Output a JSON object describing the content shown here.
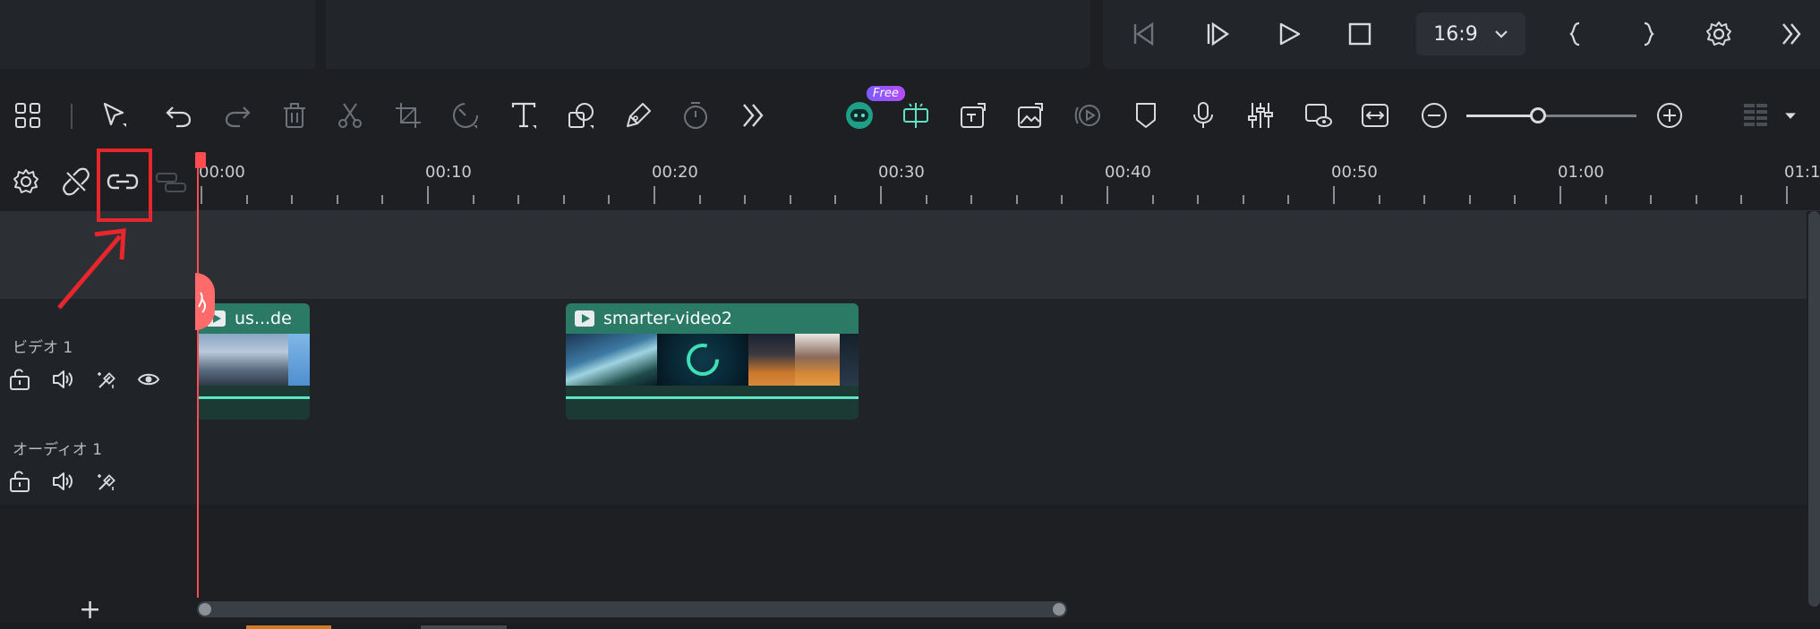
{
  "player": {
    "aspect_ratio": "16:9",
    "buttons": [
      "prev-frame",
      "next-frame",
      "play",
      "stop",
      "mark-in",
      "mark-out",
      "settings",
      "more"
    ]
  },
  "toolbar": {
    "ai_badge": "Free",
    "icons": [
      "layout-icon",
      "select-icon",
      "undo-icon",
      "redo-icon",
      "delete-icon",
      "cut-icon",
      "crop-icon",
      "speed-icon",
      "text-icon",
      "shape-icon",
      "pen-icon",
      "timer-icon",
      "more-icon",
      "ai-robot-icon",
      "split-screen-icon",
      "export-icon",
      "image-edit-icon",
      "motion-icon",
      "marker-icon",
      "mic-icon",
      "mixer-icon",
      "preview-icon",
      "fit-icon",
      "zoom-out-icon",
      "zoom-in-icon",
      "grid-icon",
      "dropdown-icon"
    ],
    "zoom_level": 0.42
  },
  "track_header_icons": [
    "gear-icon",
    "unlink-icon",
    "link-icon",
    "chain-icon"
  ],
  "ruler": {
    "labels": [
      "00:00",
      "00:10",
      "00:20",
      "00:30",
      "00:40",
      "00:50",
      "01:00",
      "01:1"
    ]
  },
  "tracks": {
    "video": {
      "label": "ビデオ 1"
    },
    "audio": {
      "label": "オーディオ 1"
    }
  },
  "clips": [
    {
      "name": "us...de"
    },
    {
      "name": "smarter-video2"
    }
  ],
  "add_track_label": "+",
  "colors": {
    "accent": "#2a7a65",
    "clip_line": "#5fe3c4",
    "playhead": "#ff4d4f",
    "annotation": "#e8262d"
  }
}
